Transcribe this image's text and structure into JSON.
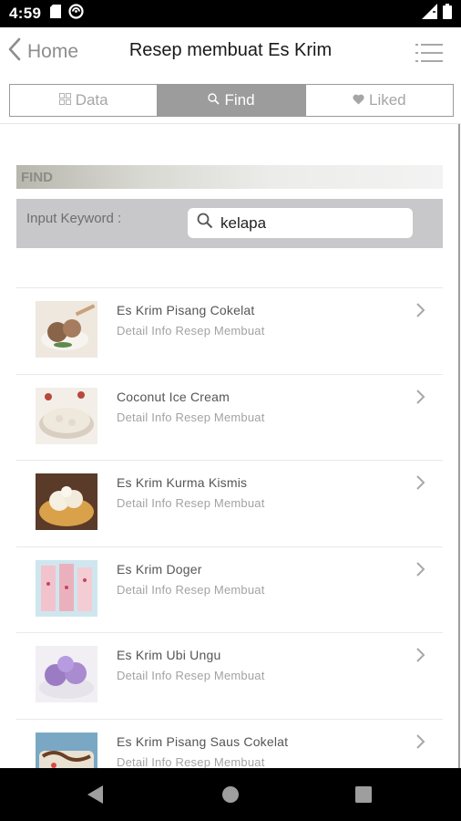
{
  "status_bar": {
    "time": "4:59",
    "left_icons": [
      "sd-card-icon",
      "sync-icon"
    ],
    "right_icons": [
      "signal-icon",
      "battery-icon"
    ]
  },
  "header": {
    "back_label": "Home",
    "title": "Resep membuat Es Krim",
    "menu_icon": "list-menu-icon"
  },
  "tabs": [
    {
      "label": "Data",
      "icon": "grid-icon",
      "active": false
    },
    {
      "label": "Find",
      "icon": "search-icon",
      "active": true
    },
    {
      "label": "Liked",
      "icon": "heart-icon",
      "active": false
    }
  ],
  "find": {
    "section_title": "FIND",
    "keyword_label": "Input Keyword :",
    "keyword_value": "kelapa"
  },
  "results": [
    {
      "title": "Es Krim Pisang Cokelat",
      "subtitle": "Detail Info Resep Membuat",
      "thumb_color": "#a57c5e"
    },
    {
      "title": "Coconut Ice Cream",
      "subtitle": "Detail Info Resep Membuat",
      "thumb_color": "#e9e1d4"
    },
    {
      "title": "Es Krim Kurma Kismis",
      "subtitle": "Detail Info Resep Membuat",
      "thumb_color": "#d9a24a"
    },
    {
      "title": "Es Krim Doger",
      "subtitle": "Detail Info Resep Membuat",
      "thumb_color": "#e9a9b7"
    },
    {
      "title": "Es Krim Ubi Ungu",
      "subtitle": "Detail Info Resep Membuat",
      "thumb_color": "#9b7cc4"
    },
    {
      "title": "Es Krim Pisang Saus Cokelat",
      "subtitle": "Detail Info Resep Membuat",
      "thumb_color": "#7aa8c4"
    }
  ],
  "nav_bar": {
    "buttons": [
      "back-triangle-icon",
      "home-circle-icon",
      "recents-square-icon"
    ]
  },
  "colors": {
    "active_tab": "#9c9c9c",
    "panel": "#c8c8cb",
    "text_muted": "#a3a3a3"
  }
}
